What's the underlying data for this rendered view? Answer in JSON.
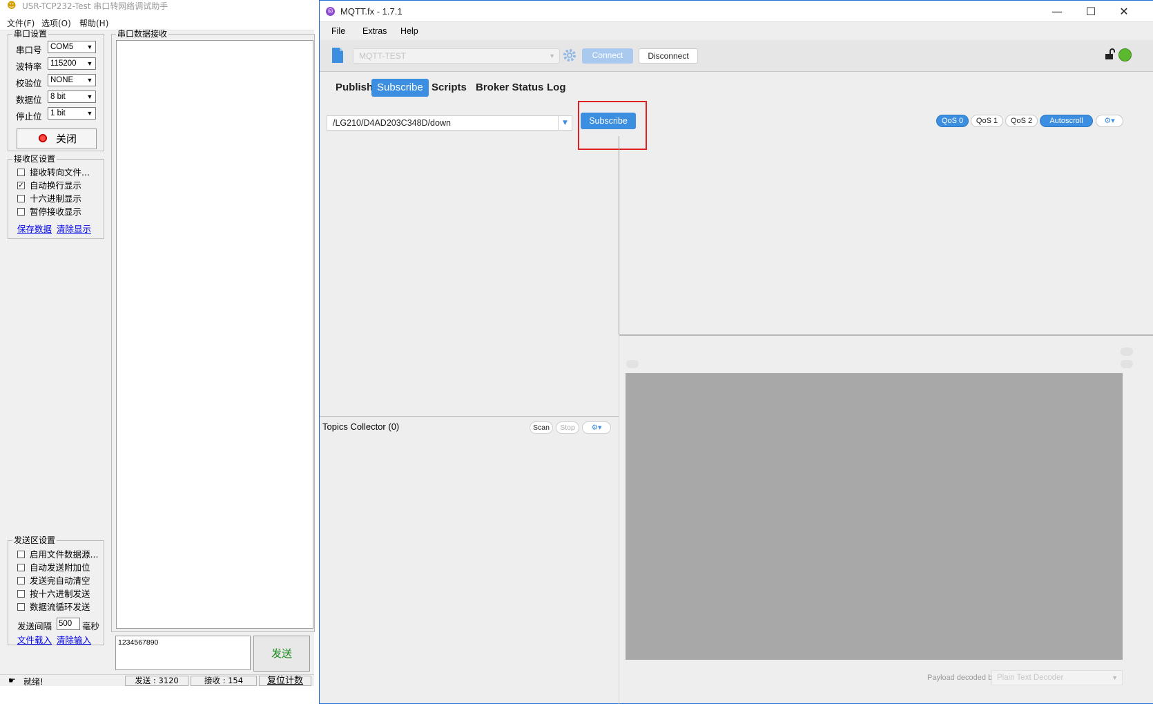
{
  "usr": {
    "title": "USR-TCP232-Test 串口转网络调试助手",
    "menu": [
      "文件(F)",
      "选项(O)",
      "帮助(H)"
    ],
    "serial_group": "串口设置",
    "fields": [
      {
        "label": "串口号",
        "value": "COM5"
      },
      {
        "label": "波特率",
        "value": "115200"
      },
      {
        "label": "校验位",
        "value": "NONE"
      },
      {
        "label": "数据位",
        "value": "8 bit"
      },
      {
        "label": "停止位",
        "value": "1 bit"
      }
    ],
    "close_button": "关闭",
    "recv_group": "接收区设置",
    "recv_options": [
      {
        "label": "接收转向文件...",
        "checked": false
      },
      {
        "label": "自动换行显示",
        "checked": true
      },
      {
        "label": "十六进制显示",
        "checked": false
      },
      {
        "label": "暂停接收显示",
        "checked": false
      }
    ],
    "recv_links": [
      "保存数据",
      "清除显示"
    ],
    "recv_area_title": "串口数据接收",
    "send_group": "发送区设置",
    "send_options": [
      {
        "label": "启用文件数据源...",
        "checked": false
      },
      {
        "label": "自动发送附加位",
        "checked": false
      },
      {
        "label": "发送完自动清空",
        "checked": false
      },
      {
        "label": "按十六进制发送",
        "checked": false
      },
      {
        "label": "数据流循环发送",
        "checked": false
      }
    ],
    "interval_label": "发送间隔",
    "interval_value": "500",
    "interval_unit": "毫秒",
    "send_links": [
      "文件载入",
      "清除输入"
    ],
    "send_input": "1234567890",
    "send_button": "发送",
    "status_ready": "就绪!",
    "status_sent": "发送 : 3120",
    "status_recv": "接收 : 154",
    "status_reset": "复位计数"
  },
  "mqtt": {
    "title": "MQTT.fx - 1.7.1",
    "menu": [
      "File",
      "Extras",
      "Help"
    ],
    "profile": "MQTT-TEST",
    "connect": "Connect",
    "disconnect": "Disconnect",
    "tabs": [
      "Publish",
      "Subscribe",
      "Scripts",
      "Broker Status",
      "Log"
    ],
    "active_tab": "Subscribe",
    "topic": "/LG210/D4AD203C348D/down",
    "subscribe_button": "Subscribe",
    "qos": [
      "QoS 0",
      "QoS 1",
      "QoS 2"
    ],
    "autoscroll": "Autoscroll",
    "topics_collector": "Topics Collector (0)",
    "scan": "Scan",
    "stop": "Stop",
    "payload_label": "Payload decoded by",
    "decoder": "Plain Text Decoder",
    "colors": {
      "accent": "#3c8fe0",
      "connected": "#5cb82e",
      "highlight": "#e02020"
    }
  }
}
